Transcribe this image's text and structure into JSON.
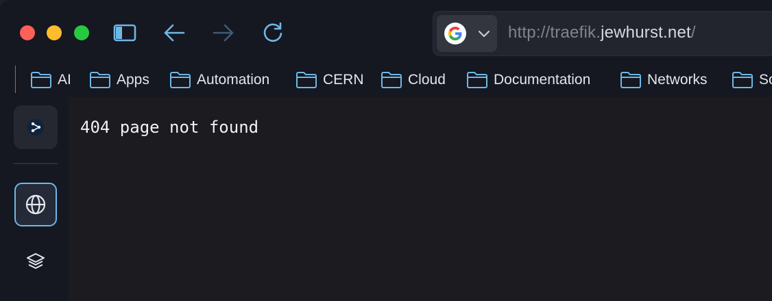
{
  "window": {
    "traffic_lights": [
      "close",
      "minimize",
      "zoom"
    ],
    "accent_color": "#6fb8e6"
  },
  "toolbar": {
    "sidebar_toggle_icon": "sidebar-icon",
    "back_icon": "arrow-left-icon",
    "forward_icon": "arrow-right-icon",
    "reload_icon": "reload-icon"
  },
  "urlbar": {
    "engine_icon": "google-icon",
    "url_prefix": "http://traefik.",
    "url_domain": "jewhurst.net",
    "url_suffix": "/"
  },
  "bookmarks": {
    "items": [
      {
        "label": "AI"
      },
      {
        "label": "Apps"
      },
      {
        "label": "Automation"
      },
      {
        "label": "CERN"
      },
      {
        "label": "Cloud"
      },
      {
        "label": "Documentation"
      },
      {
        "label": "Networks"
      },
      {
        "label": "So"
      }
    ]
  },
  "sidebar": {
    "items": [
      {
        "icon": "share-icon",
        "active": false
      },
      {
        "icon": "globe-icon",
        "active": true
      },
      {
        "icon": "layers-icon",
        "active": false
      }
    ]
  },
  "page": {
    "body_text": "404 page not found"
  }
}
